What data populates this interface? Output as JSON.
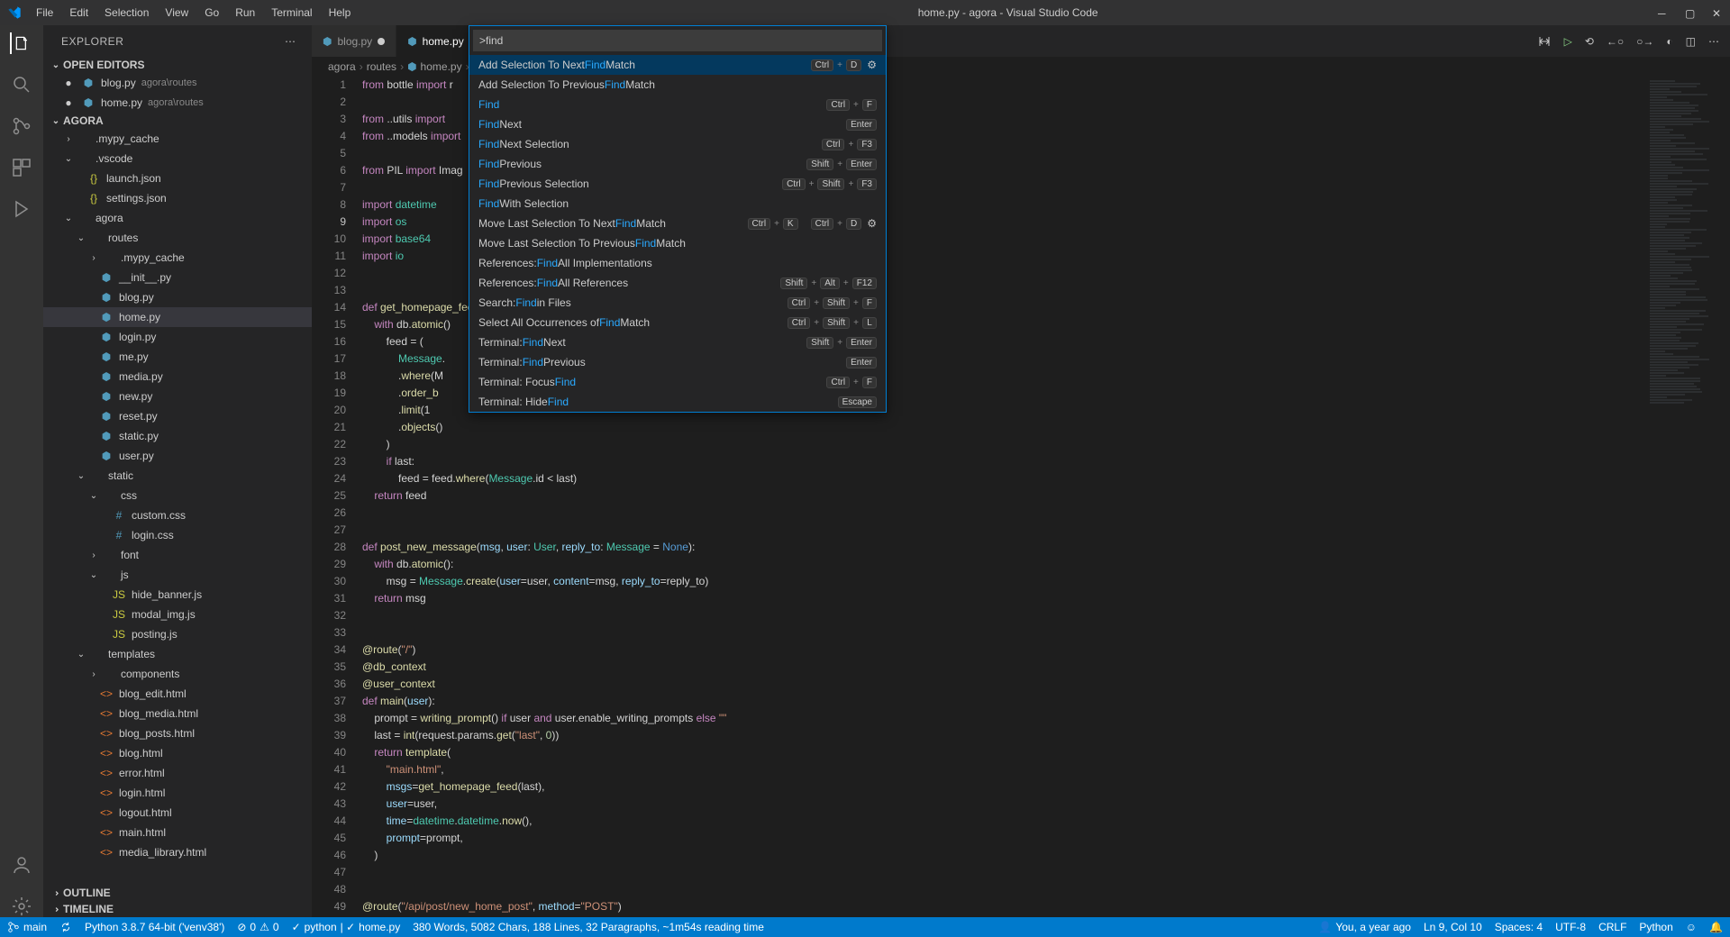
{
  "title": "home.py - agora - Visual Studio Code",
  "menu": [
    "File",
    "Edit",
    "Selection",
    "View",
    "Go",
    "Run",
    "Terminal",
    "Help"
  ],
  "sidebar": {
    "title": "EXPLORER",
    "openEditors": "OPEN EDITORS",
    "editors": [
      {
        "icon": "py",
        "name": "blog.py",
        "desc": "agora\\routes",
        "dirty": true
      },
      {
        "icon": "py",
        "name": "home.py",
        "desc": "agora\\routes",
        "dirty": true
      }
    ],
    "workspace": "AGORA",
    "tree": [
      {
        "d": 1,
        "t": "folder",
        "chev": ">",
        "name": ".mypy_cache"
      },
      {
        "d": 1,
        "t": "folder",
        "chev": "v",
        "name": ".vscode"
      },
      {
        "d": 2,
        "t": "json",
        "name": "launch.json"
      },
      {
        "d": 2,
        "t": "json",
        "name": "settings.json"
      },
      {
        "d": 1,
        "t": "folder",
        "chev": "v",
        "name": "agora"
      },
      {
        "d": 2,
        "t": "folder",
        "chev": "v",
        "name": "routes"
      },
      {
        "d": 3,
        "t": "folder",
        "chev": ">",
        "name": ".mypy_cache"
      },
      {
        "d": 3,
        "t": "py",
        "name": "__init__.py"
      },
      {
        "d": 3,
        "t": "py",
        "name": "blog.py"
      },
      {
        "d": 3,
        "t": "py",
        "name": "home.py",
        "sel": true
      },
      {
        "d": 3,
        "t": "py",
        "name": "login.py"
      },
      {
        "d": 3,
        "t": "py",
        "name": "me.py"
      },
      {
        "d": 3,
        "t": "py",
        "name": "media.py"
      },
      {
        "d": 3,
        "t": "py",
        "name": "new.py"
      },
      {
        "d": 3,
        "t": "py",
        "name": "reset.py"
      },
      {
        "d": 3,
        "t": "py",
        "name": "static.py"
      },
      {
        "d": 3,
        "t": "py",
        "name": "user.py"
      },
      {
        "d": 2,
        "t": "folder",
        "chev": "v",
        "name": "static"
      },
      {
        "d": 3,
        "t": "folder",
        "chev": "v",
        "name": "css"
      },
      {
        "d": 4,
        "t": "css",
        "name": "custom.css"
      },
      {
        "d": 4,
        "t": "css",
        "name": "login.css"
      },
      {
        "d": 3,
        "t": "folder",
        "chev": ">",
        "name": "font"
      },
      {
        "d": 3,
        "t": "folder",
        "chev": "v",
        "name": "js"
      },
      {
        "d": 4,
        "t": "js",
        "name": "hide_banner.js"
      },
      {
        "d": 4,
        "t": "js",
        "name": "modal_img.js"
      },
      {
        "d": 4,
        "t": "js",
        "name": "posting.js"
      },
      {
        "d": 2,
        "t": "folder",
        "chev": "v",
        "name": "templates"
      },
      {
        "d": 3,
        "t": "folder",
        "chev": ">",
        "name": "components"
      },
      {
        "d": 3,
        "t": "html",
        "name": "blog_edit.html"
      },
      {
        "d": 3,
        "t": "html",
        "name": "blog_media.html"
      },
      {
        "d": 3,
        "t": "html",
        "name": "blog_posts.html"
      },
      {
        "d": 3,
        "t": "html",
        "name": "blog.html"
      },
      {
        "d": 3,
        "t": "html",
        "name": "error.html"
      },
      {
        "d": 3,
        "t": "html",
        "name": "login.html"
      },
      {
        "d": 3,
        "t": "html",
        "name": "logout.html"
      },
      {
        "d": 3,
        "t": "html",
        "name": "main.html"
      },
      {
        "d": 3,
        "t": "html",
        "name": "media_library.html"
      }
    ],
    "outline": "OUTLINE",
    "timeline": "TIMELINE"
  },
  "tabs": [
    {
      "name": "blog.py",
      "dirty": true,
      "active": false
    },
    {
      "name": "home.py",
      "dirty": true,
      "active": true
    }
  ],
  "breadcrumbs": [
    "agora",
    "routes",
    "home.py",
    "..."
  ],
  "palette": {
    "input": ">find",
    "items": [
      {
        "pre": "Add Selection To Next ",
        "hl": "Find",
        "post": " Match",
        "keys": [
          "Ctrl",
          "+",
          "D"
        ],
        "gear": true,
        "sel": true
      },
      {
        "pre": "Add Selection To Previous ",
        "hl": "Find",
        "post": " Match"
      },
      {
        "pre": "",
        "hl": "Find",
        "post": "",
        "keys": [
          "Ctrl",
          "+",
          "F"
        ]
      },
      {
        "pre": "",
        "hl": "Find",
        "post": " Next",
        "keys": [
          "Enter"
        ]
      },
      {
        "pre": "",
        "hl": "Find",
        "post": " Next Selection",
        "keys": [
          "Ctrl",
          "+",
          "F3"
        ]
      },
      {
        "pre": "",
        "hl": "Find",
        "post": " Previous",
        "keys": [
          "Shift",
          "+",
          "Enter"
        ]
      },
      {
        "pre": "",
        "hl": "Find",
        "post": " Previous Selection",
        "keys": [
          "Ctrl",
          "+",
          "Shift",
          "+",
          "F3"
        ]
      },
      {
        "pre": "",
        "hl": "Find",
        "post": " With Selection"
      },
      {
        "pre": "Move Last Selection To Next ",
        "hl": "Find",
        "post": " Match",
        "keys": [
          "Ctrl",
          "+",
          "K",
          "",
          "Ctrl",
          "+",
          "D"
        ],
        "gear": true
      },
      {
        "pre": "Move Last Selection To Previous ",
        "hl": "Find",
        "post": " Match"
      },
      {
        "pre": "References: ",
        "hl": "Find",
        "post": " All Implementations"
      },
      {
        "pre": "References: ",
        "hl": "Find",
        "post": " All References",
        "keys": [
          "Shift",
          "+",
          "Alt",
          "+",
          "F12"
        ]
      },
      {
        "pre": "Search: ",
        "hl": "Find",
        "post": " in Files",
        "keys": [
          "Ctrl",
          "+",
          "Shift",
          "+",
          "F"
        ]
      },
      {
        "pre": "Select All Occurrences of ",
        "hl": "Find",
        "post": " Match",
        "keys": [
          "Ctrl",
          "+",
          "Shift",
          "+",
          "L"
        ]
      },
      {
        "pre": "Terminal: ",
        "hl": "Find",
        "post": " Next",
        "keys": [
          "Shift",
          "+",
          "Enter"
        ]
      },
      {
        "pre": "Terminal: ",
        "hl": "Find",
        "post": " Previous",
        "keys": [
          "Enter"
        ]
      },
      {
        "pre": "Terminal: Focus ",
        "hl": "Find",
        "post": "",
        "keys": [
          "Ctrl",
          "+",
          "F"
        ]
      },
      {
        "pre": "Terminal: Hide ",
        "hl": "Find",
        "post": "",
        "keys": [
          "Escape"
        ]
      }
    ]
  },
  "code": [
    {
      "n": 1,
      "h": "<span class='kw'>from</span> bottle <span class='kw'>import</span> r"
    },
    {
      "n": 2,
      "h": ""
    },
    {
      "n": 3,
      "h": "<span class='kw'>from</span> ..utils <span class='kw'>import</span>"
    },
    {
      "n": 4,
      "h": "<span class='kw'>from</span> ..models <span class='kw'>import</span>"
    },
    {
      "n": 5,
      "h": ""
    },
    {
      "n": 6,
      "h": "<span class='kw'>from</span> PIL <span class='kw'>import</span> Imag"
    },
    {
      "n": 7,
      "h": ""
    },
    {
      "n": 8,
      "h": "<span class='kw'>import</span> <span class='cls'>datetime</span>"
    },
    {
      "n": 9,
      "h": "<span class='kw'>import</span> <span class='cls'>os</span>",
      "cur": true
    },
    {
      "n": 10,
      "h": "<span class='kw'>import</span> <span class='cls'>base64</span>"
    },
    {
      "n": 11,
      "h": "<span class='kw'>import</span> <span class='cls'>io</span>"
    },
    {
      "n": 12,
      "h": ""
    },
    {
      "n": 13,
      "h": ""
    },
    {
      "n": 14,
      "h": "<span class='kw'>def</span> <span class='fn'>get_homepage_fee</span>"
    },
    {
      "n": 15,
      "h": "    <span class='kw'>with</span> db.<span class='fn'>atomic</span>()"
    },
    {
      "n": 16,
      "h": "        feed <span class='op'>=</span> ("
    },
    {
      "n": 17,
      "h": "            <span class='cls'>Message</span>."
    },
    {
      "n": 18,
      "h": "            .<span class='fn'>where</span>(M"
    },
    {
      "n": 19,
      "h": "            .<span class='fn'>order_b</span>"
    },
    {
      "n": 20,
      "h": "            .<span class='fn'>limit</span>(1"
    },
    {
      "n": 21,
      "h": "            .<span class='fn'>objects</span>()"
    },
    {
      "n": 22,
      "h": "        )"
    },
    {
      "n": 23,
      "h": "        <span class='kw'>if</span> last:"
    },
    {
      "n": 24,
      "h": "            feed <span class='op'>=</span> feed.<span class='fn'>where</span>(<span class='cls'>Message</span>.id <span class='op'>&lt;</span> last)"
    },
    {
      "n": 25,
      "h": "    <span class='kw'>return</span> feed"
    },
    {
      "n": 26,
      "h": ""
    },
    {
      "n": 27,
      "h": ""
    },
    {
      "n": 28,
      "h": "<span class='kw'>def</span> <span class='fn'>post_new_message</span>(<span class='param'>msg</span>, <span class='param'>user</span>: <span class='cls'>User</span>, <span class='param'>reply_to</span>: <span class='cls'>Message</span> <span class='op'>=</span> <span class='const'>None</span>):"
    },
    {
      "n": 29,
      "h": "    <span class='kw'>with</span> db.<span class='fn'>atomic</span>():"
    },
    {
      "n": 30,
      "h": "        msg <span class='op'>=</span> <span class='cls'>Message</span>.<span class='fn'>create</span>(<span class='param'>user</span><span class='op'>=</span>user, <span class='param'>content</span><span class='op'>=</span>msg, <span class='param'>reply_to</span><span class='op'>=</span>reply_to)"
    },
    {
      "n": 31,
      "h": "    <span class='kw'>return</span> msg"
    },
    {
      "n": 32,
      "h": ""
    },
    {
      "n": 33,
      "h": ""
    },
    {
      "n": 34,
      "h": "<span class='dec'>@route</span>(<span class='str'>\"/\"</span>)"
    },
    {
      "n": 35,
      "h": "<span class='dec'>@db_context</span>"
    },
    {
      "n": 36,
      "h": "<span class='dec'>@user_context</span>"
    },
    {
      "n": 37,
      "h": "<span class='kw'>def</span> <span class='fn'>main</span>(<span class='param'>user</span>):"
    },
    {
      "n": 38,
      "h": "    prompt <span class='op'>=</span> <span class='fn'>writing_prompt</span>() <span class='kw'>if</span> user <span class='kw'>and</span> user.enable_writing_prompts <span class='kw'>else</span> <span class='str'>\"\"</span>"
    },
    {
      "n": 39,
      "h": "    last <span class='op'>=</span> <span class='fn'>int</span>(request.params.<span class='fn'>get</span>(<span class='str'>\"last\"</span>, <span class='num'>0</span>))"
    },
    {
      "n": 40,
      "h": "    <span class='kw'>return</span> <span class='fn'>template</span>("
    },
    {
      "n": 41,
      "h": "        <span class='str'>\"main.html\"</span>,"
    },
    {
      "n": 42,
      "h": "        <span class='param'>msgs</span><span class='op'>=</span><span class='fn'>get_homepage_feed</span>(last),"
    },
    {
      "n": 43,
      "h": "        <span class='param'>user</span><span class='op'>=</span>user,"
    },
    {
      "n": 44,
      "h": "        <span class='param'>time</span><span class='op'>=</span><span class='cls'>datetime</span>.<span class='cls'>datetime</span>.<span class='fn'>now</span>(),"
    },
    {
      "n": 45,
      "h": "        <span class='param'>prompt</span><span class='op'>=</span>prompt,"
    },
    {
      "n": 46,
      "h": "    )"
    },
    {
      "n": 47,
      "h": ""
    },
    {
      "n": 48,
      "h": ""
    },
    {
      "n": 49,
      "h": "<span class='dec'>@route</span>(<span class='str'>\"/api/post/new_home_post\"</span>, <span class='param'>method</span><span class='op'>=</span><span class='str'>\"POST\"</span>)"
    }
  ],
  "status": {
    "branch": "main",
    "python": "Python 3.8.7 64-bit ('venv38')",
    "errors": "0",
    "warnings": "0",
    "lint": "python",
    "file": "home.py",
    "stats": "380 Words, 5082 Chars, 188 Lines, 32 Paragraphs, ~1m54s reading time",
    "blame": "You, a year ago",
    "pos": "Ln 9, Col 10",
    "spaces": "Spaces: 4",
    "enc": "UTF-8",
    "eol": "CRLF",
    "lang": "Python"
  }
}
